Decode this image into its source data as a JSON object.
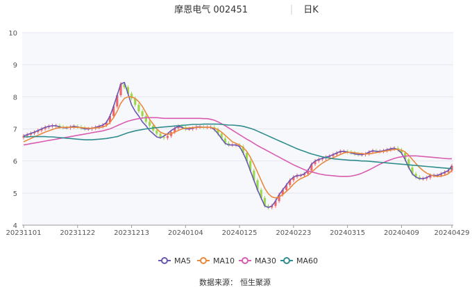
{
  "header": {
    "stock_title": "摩恩电气 002451",
    "period_label": "日K"
  },
  "source": {
    "label": "数据来源：",
    "value": "恒生聚源"
  },
  "colors": {
    "up": "#f0676a",
    "down": "#9ad94a",
    "MA5": "#6b55b5",
    "MA10": "#e8883c",
    "MA30": "#d85bb0",
    "MA60": "#2f8c8c",
    "grid": "#e6e6f0",
    "plot_bg": "#f7f8fc"
  },
  "chart_data": {
    "type": "candlestick",
    "ylim": [
      4,
      10
    ],
    "y_ticks": [
      4,
      5,
      6,
      7,
      8,
      9,
      10
    ],
    "x_tick_labels": [
      "20231101",
      "20231122",
      "20231213",
      "20240104",
      "20240125",
      "20240223",
      "20240315",
      "20240409",
      "20240429"
    ],
    "x_tick_index": [
      0,
      15,
      30,
      45,
      60,
      75,
      90,
      105,
      119
    ],
    "closes": [
      6.78,
      6.82,
      6.86,
      6.9,
      6.95,
      7.0,
      7.05,
      7.08,
      7.1,
      7.1,
      7.06,
      7.04,
      7.03,
      7.06,
      7.08,
      7.06,
      7.03,
      7.0,
      7.0,
      7.02,
      7.05,
      7.08,
      7.12,
      7.2,
      7.4,
      7.7,
      8.05,
      8.4,
      8.3,
      8.1,
      7.95,
      7.75,
      7.55,
      7.4,
      7.22,
      7.1,
      6.95,
      6.85,
      6.75,
      6.72,
      6.78,
      6.9,
      7.02,
      7.08,
      7.05,
      7.0,
      7.0,
      7.02,
      7.06,
      7.06,
      7.05,
      7.05,
      7.05,
      6.98,
      6.85,
      6.7,
      6.55,
      6.5,
      6.5,
      6.5,
      6.45,
      6.25,
      6.0,
      5.7,
      5.4,
      5.1,
      4.85,
      4.6,
      4.55,
      4.6,
      4.75,
      4.95,
      5.1,
      5.25,
      5.4,
      5.5,
      5.55,
      5.55,
      5.6,
      5.7,
      5.9,
      6.0,
      6.05,
      6.08,
      6.12,
      6.15,
      6.2,
      6.25,
      6.3,
      6.3,
      6.28,
      6.25,
      6.22,
      6.2,
      6.2,
      6.22,
      6.28,
      6.32,
      6.3,
      6.3,
      6.32,
      6.35,
      6.38,
      6.4,
      6.35,
      6.25,
      6.05,
      5.8,
      5.6,
      5.5,
      5.45,
      5.45,
      5.48,
      5.55,
      5.55,
      5.55,
      5.6,
      5.65,
      5.7,
      5.85
    ],
    "series": [
      {
        "name": "MA5",
        "values": [
          6.78,
          6.82,
          6.86,
          6.9,
          6.95,
          7.0,
          7.05,
          7.08,
          7.1,
          7.1,
          7.06,
          7.04,
          7.03,
          7.06,
          7.08,
          7.06,
          7.03,
          7.0,
          7.0,
          7.02,
          7.05,
          7.08,
          7.12,
          7.2,
          7.4,
          7.7,
          8.05,
          8.4,
          8.45,
          8.1,
          7.75,
          7.55,
          7.4,
          7.22,
          7.1,
          6.95,
          6.85,
          6.75,
          6.72,
          6.78,
          6.85,
          6.95,
          7.02,
          7.08,
          7.05,
          7.0,
          7.0,
          7.02,
          7.06,
          7.06,
          7.05,
          7.05,
          7.05,
          6.98,
          6.85,
          6.7,
          6.55,
          6.5,
          6.5,
          6.5,
          6.45,
          6.25,
          6.0,
          5.7,
          5.4,
          5.1,
          4.85,
          4.6,
          4.55,
          4.6,
          4.75,
          4.95,
          5.1,
          5.25,
          5.4,
          5.5,
          5.55,
          5.55,
          5.6,
          5.7,
          5.9,
          6.0,
          6.05,
          6.08,
          6.12,
          6.15,
          6.2,
          6.25,
          6.3,
          6.3,
          6.28,
          6.25,
          6.22,
          6.2,
          6.2,
          6.22,
          6.28,
          6.32,
          6.3,
          6.3,
          6.32,
          6.35,
          6.38,
          6.4,
          6.35,
          6.25,
          6.05,
          5.8,
          5.6,
          5.5,
          5.45,
          5.45,
          5.48,
          5.55,
          5.55,
          5.55,
          5.6,
          5.65,
          5.7,
          5.85
        ]
      },
      {
        "name": "MA10",
        "values": [
          6.6,
          6.65,
          6.7,
          6.75,
          6.8,
          6.85,
          6.9,
          6.94,
          6.98,
          7.02,
          7.04,
          7.05,
          7.05,
          7.05,
          7.05,
          7.05,
          7.04,
          7.03,
          7.02,
          7.02,
          7.03,
          7.04,
          7.06,
          7.1,
          7.2,
          7.35,
          7.55,
          7.8,
          7.95,
          8.0,
          8.0,
          7.95,
          7.85,
          7.7,
          7.5,
          7.3,
          7.15,
          7.0,
          6.9,
          6.85,
          6.83,
          6.85,
          6.9,
          6.95,
          7.0,
          7.02,
          7.03,
          7.04,
          7.05,
          7.05,
          7.05,
          7.05,
          7.05,
          7.02,
          6.98,
          6.9,
          6.8,
          6.7,
          6.6,
          6.55,
          6.5,
          6.42,
          6.3,
          6.12,
          5.9,
          5.65,
          5.4,
          5.15,
          4.98,
          4.88,
          4.85,
          4.88,
          4.95,
          5.05,
          5.15,
          5.28,
          5.38,
          5.45,
          5.5,
          5.55,
          5.65,
          5.75,
          5.85,
          5.93,
          6.0,
          6.06,
          6.1,
          6.15,
          6.2,
          6.25,
          6.27,
          6.27,
          6.26,
          6.24,
          6.23,
          6.22,
          6.22,
          6.24,
          6.26,
          6.28,
          6.3,
          6.32,
          6.34,
          6.36,
          6.36,
          6.34,
          6.28,
          6.18,
          6.05,
          5.92,
          5.8,
          5.7,
          5.62,
          5.57,
          5.53,
          5.52,
          5.53,
          5.55,
          5.6,
          5.7
        ]
      },
      {
        "name": "MA30",
        "values": [
          6.5,
          6.52,
          6.54,
          6.56,
          6.58,
          6.6,
          6.62,
          6.64,
          6.66,
          6.68,
          6.7,
          6.72,
          6.74,
          6.76,
          6.78,
          6.8,
          6.82,
          6.84,
          6.86,
          6.88,
          6.9,
          6.92,
          6.94,
          6.97,
          7.0,
          7.05,
          7.1,
          7.15,
          7.2,
          7.24,
          7.27,
          7.3,
          7.32,
          7.34,
          7.35,
          7.35,
          7.35,
          7.35,
          7.34,
          7.33,
          7.33,
          7.33,
          7.33,
          7.33,
          7.33,
          7.33,
          7.33,
          7.33,
          7.33,
          7.33,
          7.32,
          7.32,
          7.3,
          7.27,
          7.22,
          7.16,
          7.1,
          7.03,
          6.96,
          6.89,
          6.82,
          6.75,
          6.68,
          6.62,
          6.55,
          6.48,
          6.42,
          6.36,
          6.3,
          6.24,
          6.18,
          6.12,
          6.06,
          6.0,
          5.94,
          5.88,
          5.83,
          5.78,
          5.73,
          5.69,
          5.66,
          5.63,
          5.6,
          5.58,
          5.56,
          5.55,
          5.54,
          5.53,
          5.52,
          5.52,
          5.52,
          5.53,
          5.55,
          5.58,
          5.62,
          5.67,
          5.72,
          5.78,
          5.84,
          5.9,
          5.95,
          6.0,
          6.04,
          6.08,
          6.11,
          6.13,
          6.15,
          6.16,
          6.16,
          6.16,
          6.15,
          6.14,
          6.13,
          6.12,
          6.11,
          6.1,
          6.09,
          6.08,
          6.07,
          6.07
        ]
      },
      {
        "name": "MA60",
        "values": [
          6.75,
          6.75,
          6.76,
          6.76,
          6.76,
          6.76,
          6.76,
          6.75,
          6.75,
          6.74,
          6.73,
          6.72,
          6.71,
          6.7,
          6.69,
          6.68,
          6.67,
          6.66,
          6.66,
          6.66,
          6.67,
          6.68,
          6.69,
          6.7,
          6.72,
          6.74,
          6.76,
          6.8,
          6.84,
          6.88,
          6.91,
          6.94,
          6.96,
          6.98,
          7.0,
          7.01,
          7.03,
          7.04,
          7.05,
          7.06,
          7.07,
          7.08,
          7.09,
          7.1,
          7.11,
          7.12,
          7.13,
          7.14,
          7.14,
          7.14,
          7.15,
          7.15,
          7.15,
          7.15,
          7.15,
          7.14,
          7.13,
          7.12,
          7.12,
          7.11,
          7.1,
          7.08,
          7.05,
          7.02,
          6.98,
          6.93,
          6.88,
          6.83,
          6.78,
          6.73,
          6.68,
          6.63,
          6.58,
          6.53,
          6.48,
          6.43,
          6.38,
          6.34,
          6.3,
          6.26,
          6.22,
          6.19,
          6.16,
          6.13,
          6.11,
          6.09,
          6.07,
          6.06,
          6.05,
          6.04,
          6.03,
          6.02,
          6.02,
          6.01,
          6.0,
          6.0,
          5.99,
          5.98,
          5.97,
          5.96,
          5.95,
          5.94,
          5.93,
          5.92,
          5.91,
          5.9,
          5.89,
          5.88,
          5.87,
          5.86,
          5.85,
          5.84,
          5.83,
          5.82,
          5.81,
          5.8,
          5.79,
          5.78,
          5.77,
          5.76
        ]
      }
    ],
    "legend": [
      "MA5",
      "MA10",
      "MA30",
      "MA60"
    ],
    "legend_position": "bottom",
    "grid": true
  }
}
